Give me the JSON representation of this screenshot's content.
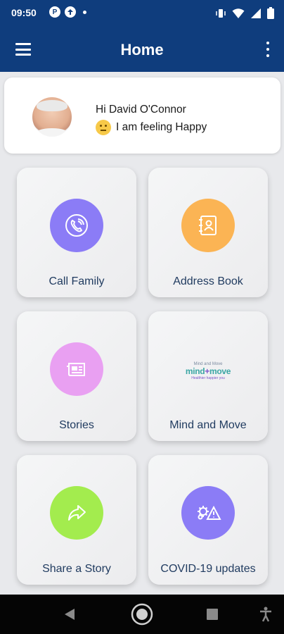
{
  "status_bar": {
    "time": "09:50",
    "left_icons": [
      "notification-p-icon",
      "notification-upload-icon",
      "dot-icon"
    ],
    "right_icons": [
      "vibrate-icon",
      "wifi-icon",
      "signal-icon",
      "battery-icon"
    ]
  },
  "app_bar": {
    "title": "Home",
    "left_icon": "hamburger-menu-icon",
    "right_icon": "overflow-menu-icon"
  },
  "profile": {
    "greeting": "Hi David O'Connor",
    "mood": "I am feeling Happy",
    "mood_icon": "neutral-face-emoji"
  },
  "tiles": [
    {
      "label": "Call Family",
      "icon": "phone-call-icon",
      "color": "#8b7cf6"
    },
    {
      "label": "Address Book",
      "icon": "address-book-icon",
      "color": "#fbb454"
    },
    {
      "label": "Stories",
      "icon": "newspaper-icon",
      "color": "#e9a0f2"
    },
    {
      "label": "Mind and Move",
      "icon": "mind-move-logo",
      "logo_small": "Mind and Move",
      "logo_main": "mind",
      "logo_plus": "+",
      "logo_main2": "move",
      "logo_tag": "Healthier happier you"
    },
    {
      "label": "Share a Story",
      "icon": "share-arrow-icon",
      "color": "#a3ec4e"
    },
    {
      "label": "COVID-19 updates",
      "icon": "virus-warning-icon",
      "color": "#8b7cf6"
    }
  ],
  "colors": {
    "brand": "#0f3d7d",
    "tile_label": "#1f3a5f"
  },
  "nav_bar": {
    "buttons": [
      "back-icon",
      "home-icon",
      "recents-icon",
      "accessibility-icon"
    ]
  }
}
